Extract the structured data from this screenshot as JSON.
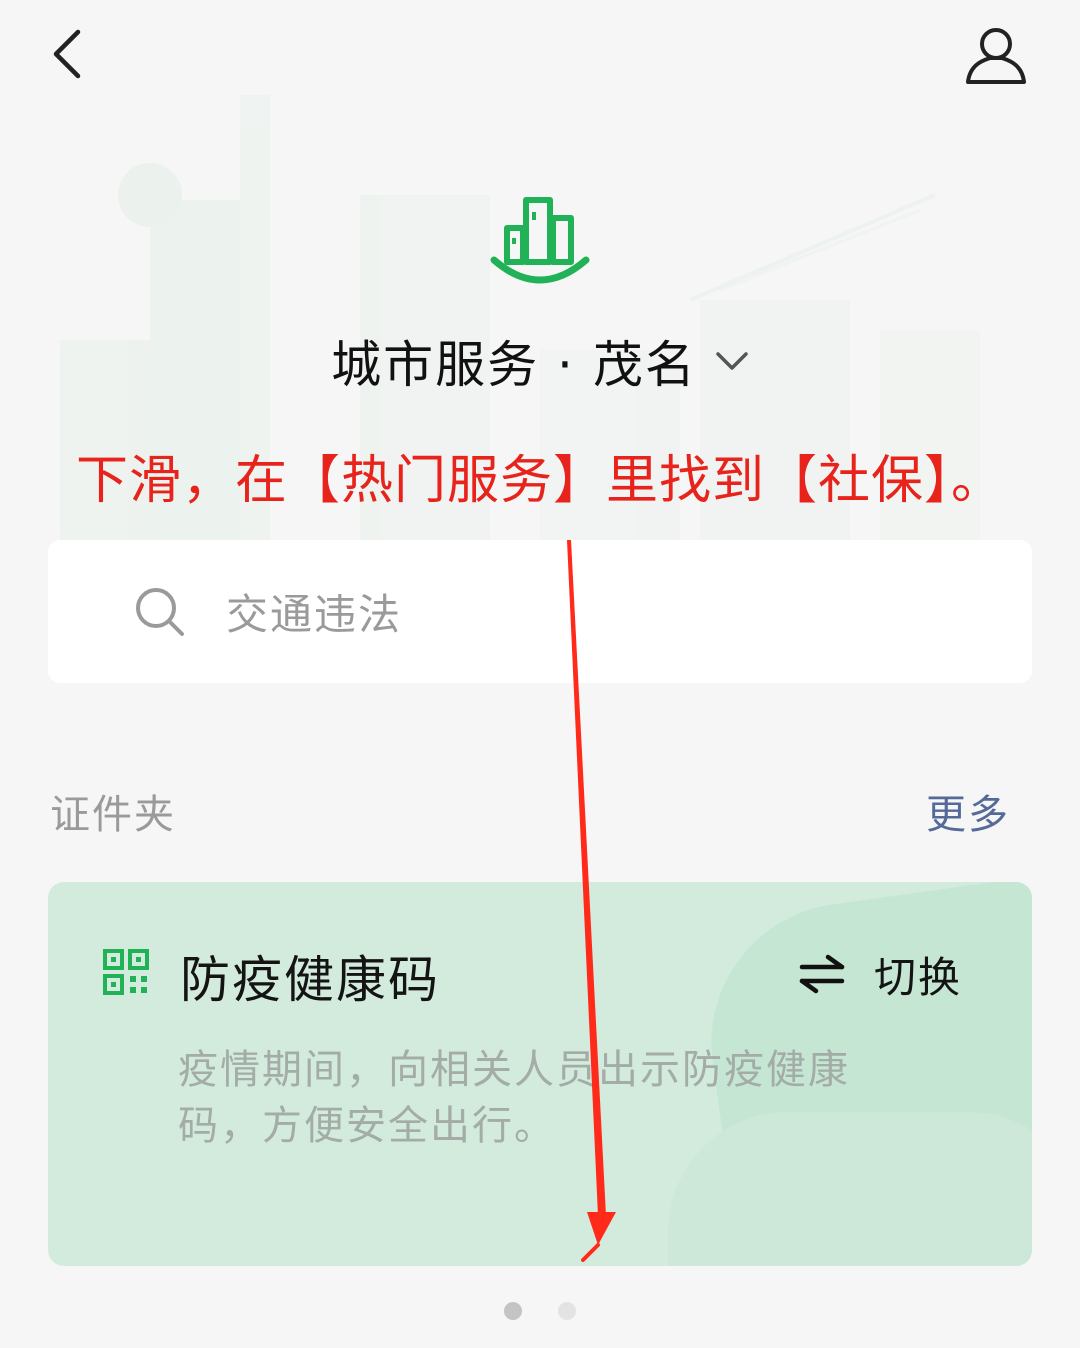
{
  "header": {
    "back_icon": "chevron-left-icon",
    "profile_icon": "user-icon"
  },
  "logo_icon": "city-buildings-icon",
  "city_title": "城市服务 · 茂名",
  "city_dropdown_icon": "chevron-down-icon",
  "instruction": "下滑，在【热门服务】里找到【社保】。",
  "search": {
    "icon": "search-icon",
    "placeholder": "交通违法"
  },
  "id_folder": {
    "title": "证件夹",
    "more": "更多"
  },
  "health_card": {
    "icon": "qr-code-icon",
    "title": "防疫健康码",
    "switch_icon": "swap-arrows-icon",
    "switch_label": "切换",
    "description": "疫情期间，向相关人员出示防疫健康码，方便安全出行。"
  },
  "pagination": {
    "total": 2,
    "active_index": 0
  },
  "colors": {
    "brand_green": "#21b156",
    "instruction_red": "#e8231b",
    "link_blue": "#556a99",
    "card_bg": "#d3ebdd",
    "dot_active": "#c4c4c4",
    "dot_inactive": "#e3e3e3"
  }
}
